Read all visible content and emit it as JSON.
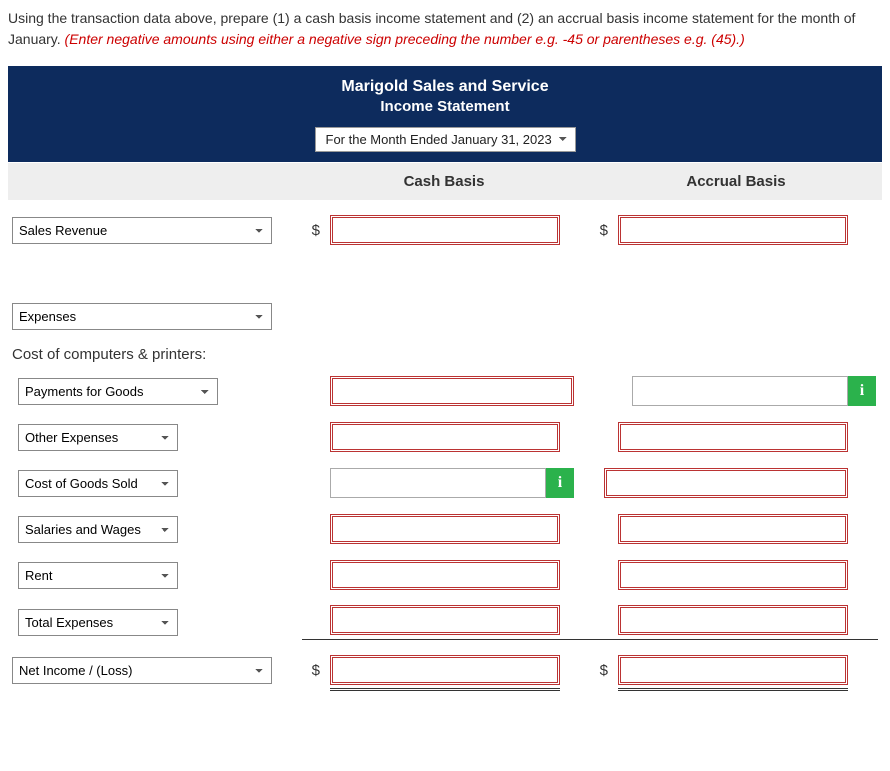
{
  "instructions": {
    "main": "Using the transaction data above, prepare (1) a cash basis income statement and (2) an accrual basis income statement for the month of January. ",
    "note": "(Enter negative amounts using either a negative sign preceding the number e.g. -45 or parentheses e.g. (45).)"
  },
  "header": {
    "company": "Marigold Sales and Service",
    "title": "Income Statement",
    "period": "For the Month Ended January 31, 2023"
  },
  "columns": {
    "cash": "Cash Basis",
    "accrual": "Accrual Basis"
  },
  "info_glyph": "i",
  "dollar": "$",
  "section_cost": "Cost of computers & printers:",
  "lines": {
    "sales_revenue": "Sales Revenue",
    "expenses": "Expenses",
    "payments_goods": "Payments for Goods",
    "other_expenses": "Other Expenses",
    "cogs": "Cost of Goods Sold",
    "salaries": "Salaries and Wages",
    "rent": "Rent",
    "total_expenses": "Total Expenses",
    "net_income": "Net Income / (Loss)"
  }
}
